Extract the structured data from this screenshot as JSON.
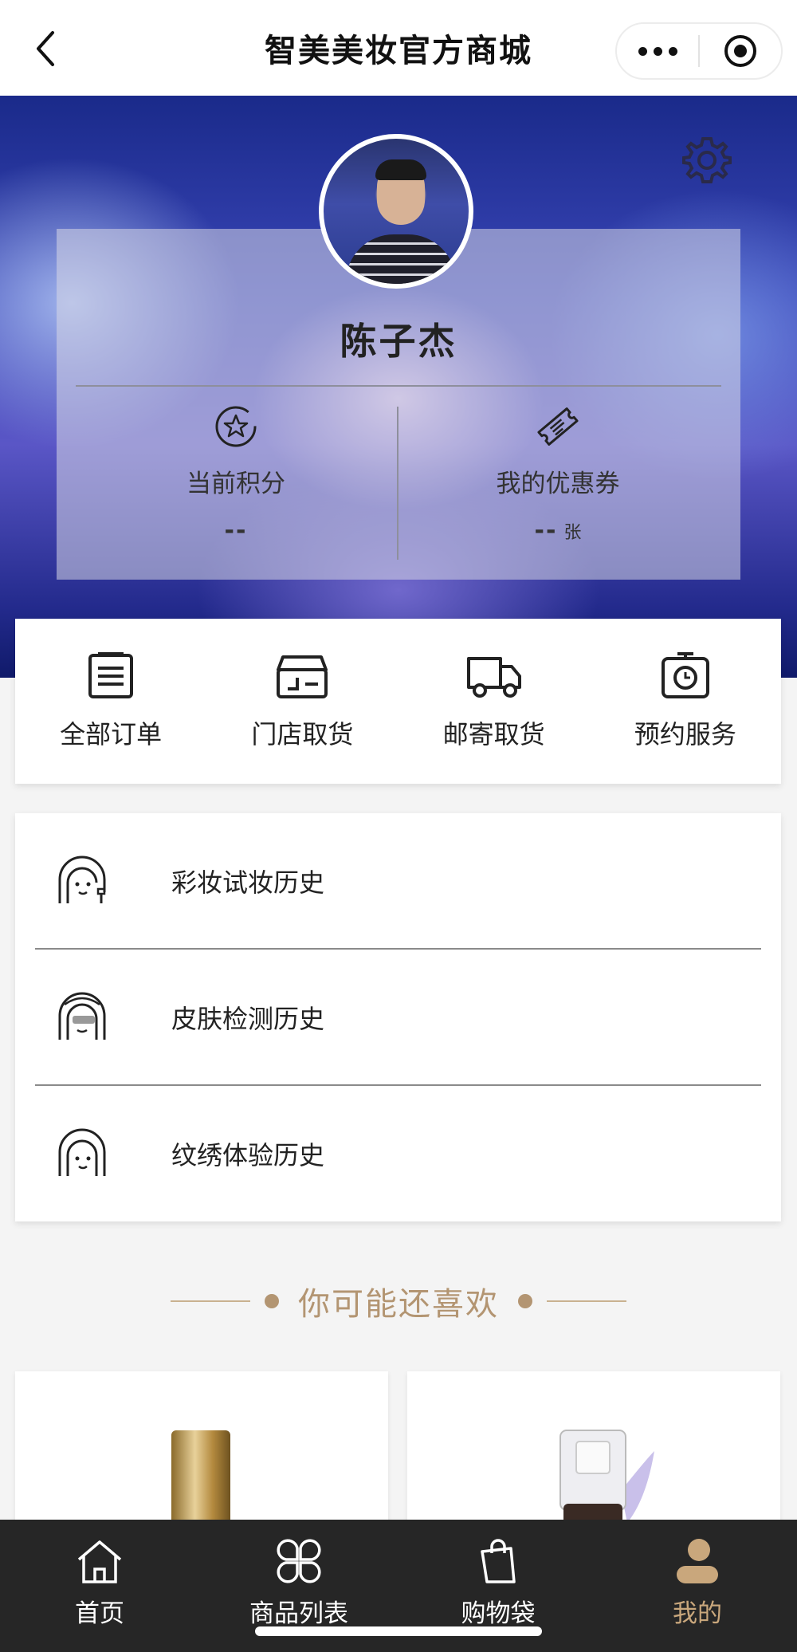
{
  "header": {
    "title": "智美美妆官方商城"
  },
  "profile": {
    "name": "陈子杰",
    "points_label": "当前积分",
    "points_value": "--",
    "coupons_label": "我的优惠券",
    "coupons_value": "--",
    "coupons_unit": "张"
  },
  "orders": [
    {
      "label": "全部订单",
      "icon": "order-list-icon"
    },
    {
      "label": "门店取货",
      "icon": "store-icon"
    },
    {
      "label": "邮寄取货",
      "icon": "truck-icon"
    },
    {
      "label": "预约服务",
      "icon": "appointment-icon"
    }
  ],
  "history": [
    {
      "label": "彩妆试妆历史",
      "icon": "makeup-face-icon"
    },
    {
      "label": "皮肤检测历史",
      "icon": "skin-face-icon"
    },
    {
      "label": "纹绣体验历史",
      "icon": "embroidery-face-icon"
    }
  ],
  "recommend": {
    "title": "你可能还喜欢"
  },
  "tabbar": [
    {
      "label": "首页",
      "icon": "home-icon",
      "active": false
    },
    {
      "label": "商品列表",
      "icon": "product-grid-icon",
      "active": false
    },
    {
      "label": "购物袋",
      "icon": "shopping-bag-icon",
      "active": false
    },
    {
      "label": "我的",
      "icon": "user-icon",
      "active": true
    }
  ],
  "colors": {
    "accent": "#b39572",
    "tabbar_bg": "#262626",
    "active_tab": "#c9a77c"
  }
}
